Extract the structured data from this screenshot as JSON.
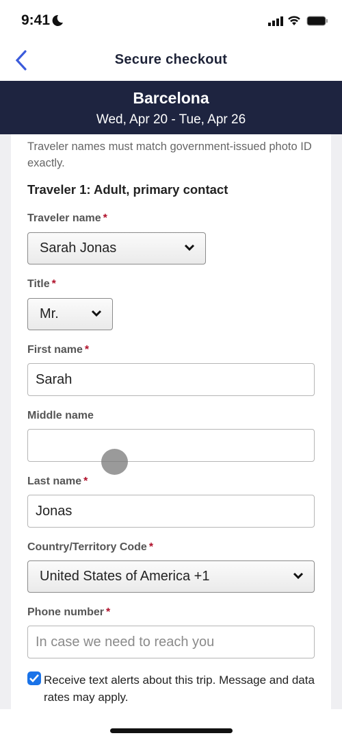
{
  "status_bar": {
    "time": "9:41",
    "icons": [
      "moon-icon",
      "signal-icon",
      "wifi-icon",
      "battery-icon"
    ]
  },
  "nav": {
    "title": "Secure checkout",
    "back_icon": "chevron-left-icon"
  },
  "banner": {
    "city": "Barcelona",
    "dates": "Wed, Apr 20 - Tue, Apr 26"
  },
  "form": {
    "note": "Traveler names must match government-issued photo ID exactly.",
    "heading": "Traveler 1: Adult, primary contact",
    "required_mark": "*",
    "traveler_name": {
      "label": "Traveler name",
      "value": "Sarah Jonas"
    },
    "title": {
      "label": "Title",
      "value": "Mr."
    },
    "first_name": {
      "label": "First name",
      "value": "Sarah"
    },
    "middle_name": {
      "label": "Middle name",
      "value": ""
    },
    "last_name": {
      "label": "Last name",
      "value": "Jonas"
    },
    "country_code": {
      "label": "Country/Territory Code",
      "value": "United States of America +1"
    },
    "phone": {
      "label": "Phone number",
      "value": "",
      "placeholder": "In case we need to reach you"
    },
    "text_alerts": {
      "label": "Receive text alerts about this trip. Message and data rates may apply.",
      "checked": true
    }
  },
  "colors": {
    "accent": "#1a73e8",
    "banner": "#1e2440",
    "required": "#b0102a",
    "back": "#3b5bdb"
  }
}
